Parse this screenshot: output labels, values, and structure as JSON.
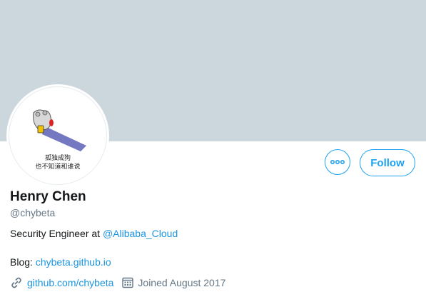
{
  "profile": {
    "name": "Henry Chen",
    "handle": "@chybeta",
    "bio_prefix": "Security Engineer at ",
    "bio_mention": "@Alibaba_Cloud",
    "blog_prefix": "Blog: ",
    "blog_link": "chybeta.github.io",
    "website": "github.com/chybeta",
    "joined": "Joined August 2017",
    "avatar_text_line1": "孤独成狗",
    "avatar_text_line2": "也不知道和谁说"
  },
  "actions": {
    "more_label": "•••",
    "follow_label": "Follow"
  },
  "colors": {
    "banner": "#ccd6dd",
    "accent": "#1da1f2",
    "secondary_text": "#657786"
  },
  "icons": {
    "more": "more-icon",
    "link": "link-icon",
    "calendar": "calendar-icon"
  }
}
